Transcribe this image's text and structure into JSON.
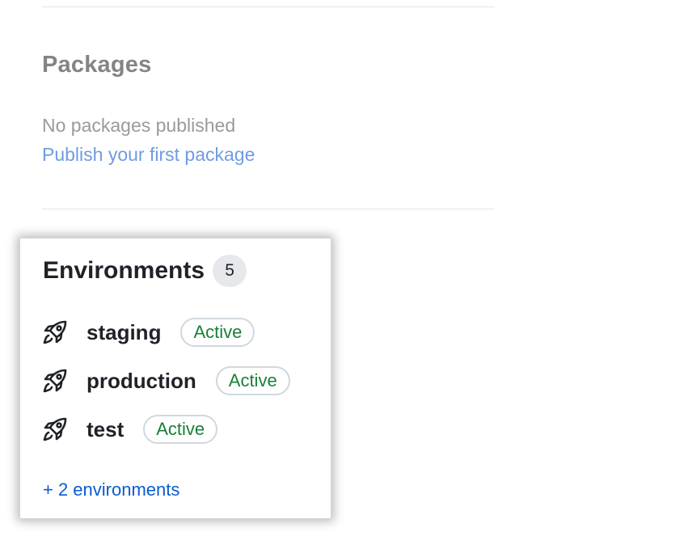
{
  "packages": {
    "title": "Packages",
    "empty_text": "No packages published",
    "publish_link": "Publish your first package"
  },
  "environments": {
    "title": "Environments",
    "count": "5",
    "items": [
      {
        "name": "staging",
        "status": "Active",
        "icon": "rocket-icon"
      },
      {
        "name": "production",
        "status": "Active",
        "icon": "rocket-icon"
      },
      {
        "name": "test",
        "status": "Active",
        "icon": "rocket-icon"
      }
    ],
    "more_link": "+ 2 environments"
  },
  "colors": {
    "status_active": "#1a7f37",
    "link": "#0a5bd3",
    "muted_link": "#6f9be3"
  }
}
